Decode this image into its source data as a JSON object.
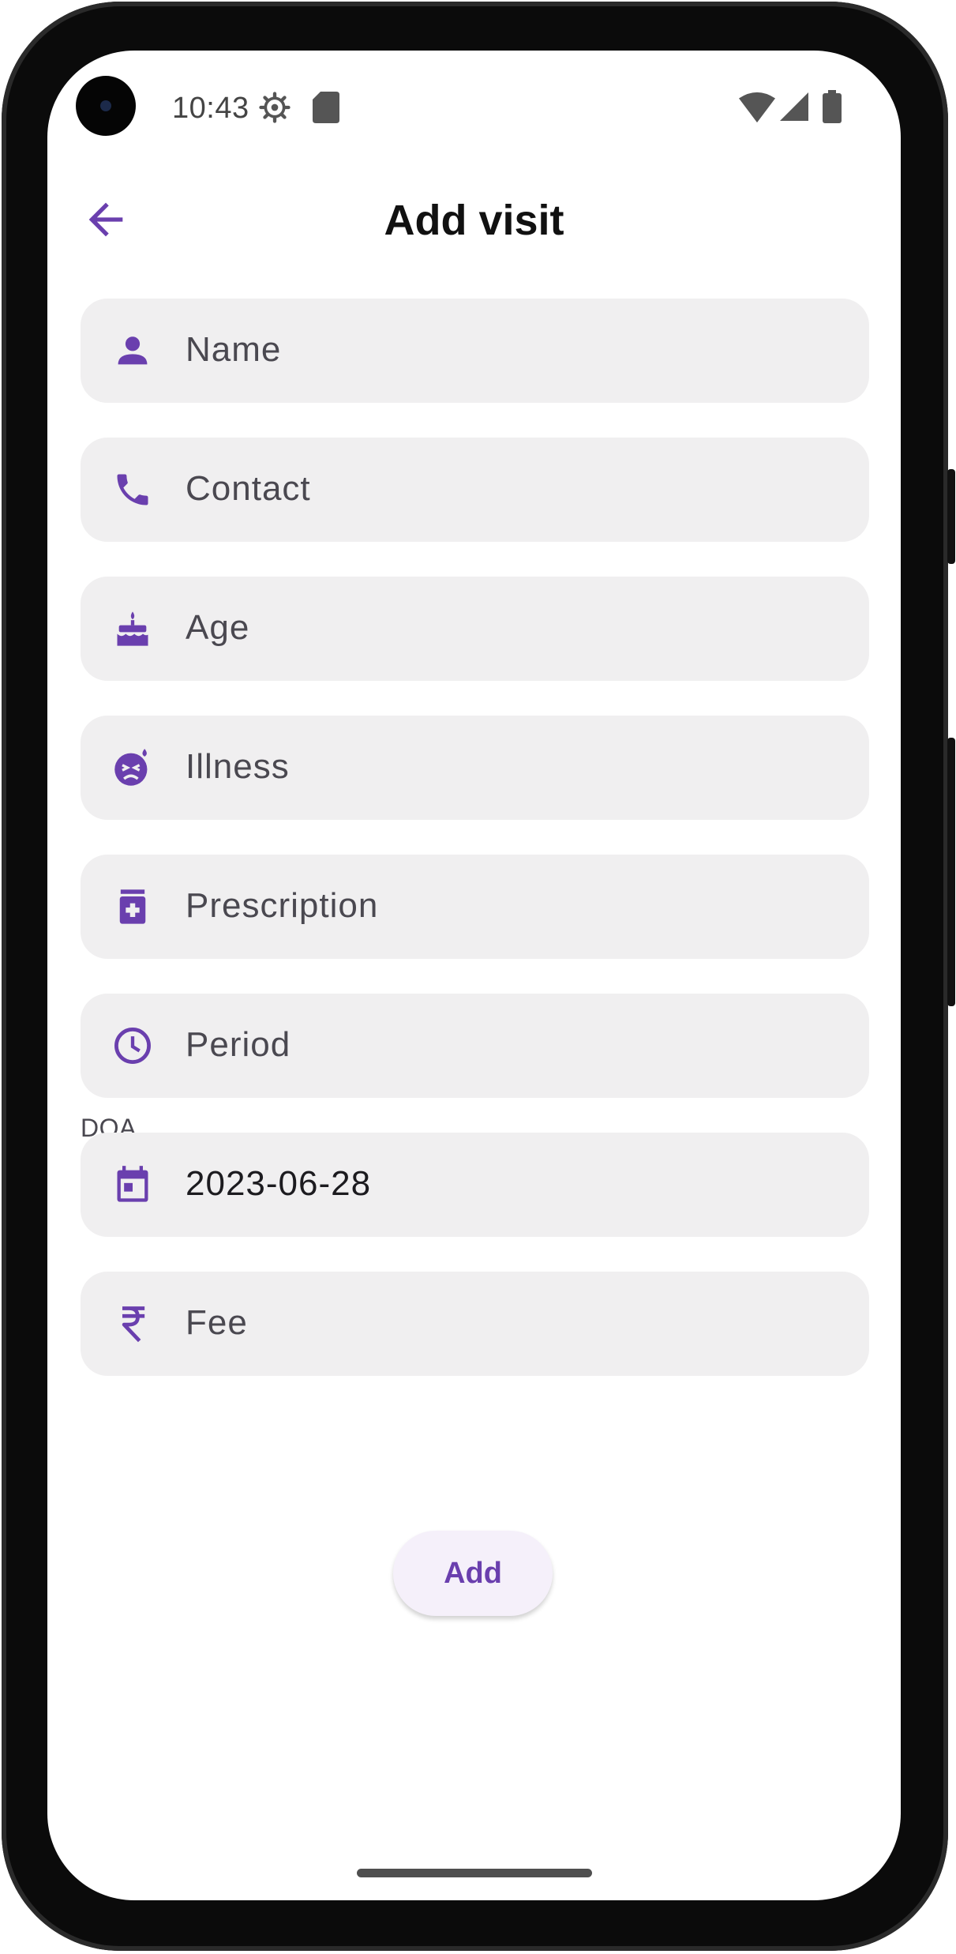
{
  "status_bar": {
    "time": "10:43",
    "icons": [
      "settings-icon",
      "sd-card-icon",
      "wifi-icon",
      "signal-icon",
      "battery-icon"
    ]
  },
  "app_bar": {
    "title": "Add visit",
    "back_icon": "arrow-back-icon"
  },
  "form": {
    "fields": [
      {
        "placeholder": "Name",
        "icon": "person-icon"
      },
      {
        "placeholder": "Contact",
        "icon": "phone-icon"
      },
      {
        "placeholder": "Age",
        "icon": "cake-icon"
      },
      {
        "placeholder": "Illness",
        "icon": "sick-face-icon"
      },
      {
        "placeholder": "Prescription",
        "icon": "medication-icon"
      },
      {
        "placeholder": "Period",
        "icon": "clock-icon"
      },
      {
        "label": "DOA",
        "value": "2023-06-28",
        "icon": "calendar-icon"
      },
      {
        "placeholder": "Fee",
        "icon": "rupee-icon"
      }
    ]
  },
  "actions": {
    "add_label": "Add"
  },
  "colors": {
    "accent": "#6a3fae",
    "field_bg": "#f0eff0",
    "button_bg": "#f5f0fa"
  }
}
